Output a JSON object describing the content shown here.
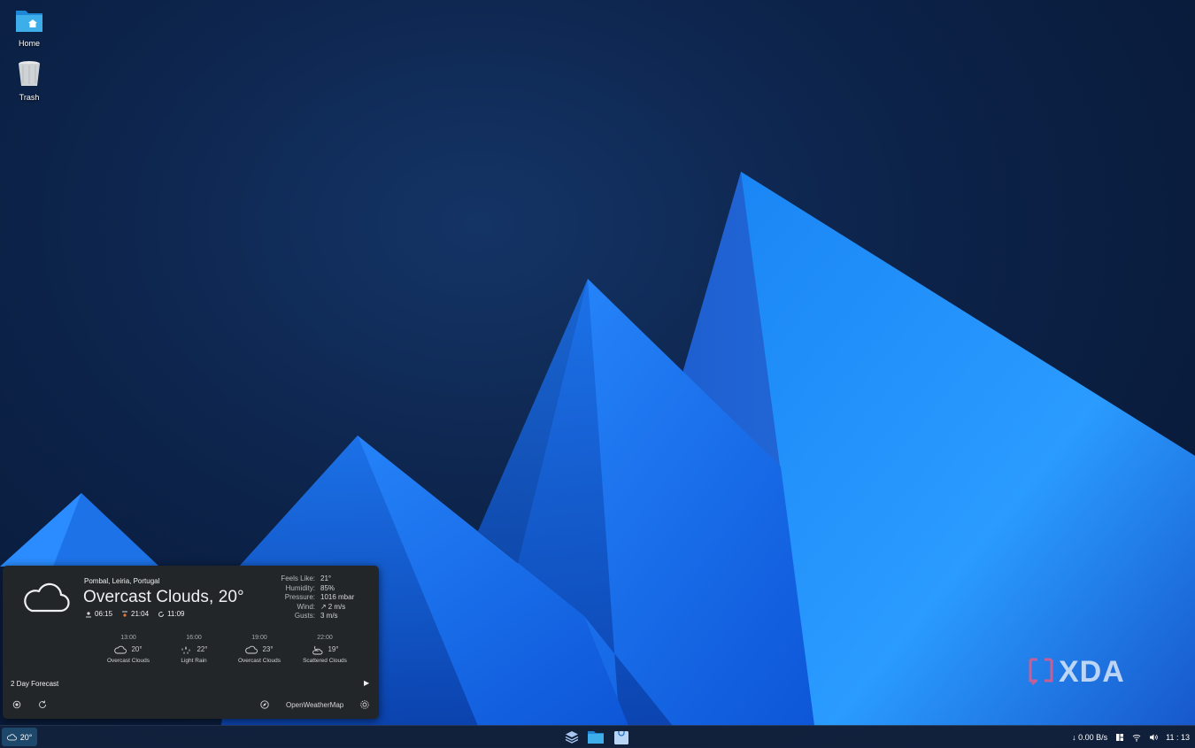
{
  "desktop": {
    "icons": [
      {
        "label": "Home",
        "icon": "folder-home-icon"
      },
      {
        "label": "Trash",
        "icon": "trash-icon"
      }
    ]
  },
  "weather": {
    "location": "Pombal, Leiria, Portugal",
    "condition": "Overcast Clouds, 20°",
    "sunrise": "06:15",
    "sunset": "21:04",
    "updated": "11:09",
    "details": [
      {
        "key": "Feels Like:",
        "value": "21°"
      },
      {
        "key": "Humidity:",
        "value": "85%"
      },
      {
        "key": "Pressure:",
        "value": "1016 mbar"
      },
      {
        "key": "Wind:",
        "value": "2 m/s"
      },
      {
        "key": "Gusts:",
        "value": "3 m/s"
      }
    ],
    "hourly": [
      {
        "time": "13:00",
        "temp": "20°",
        "desc": "Overcast Clouds",
        "icon": "cloud-icon"
      },
      {
        "time": "16:00",
        "temp": "22°",
        "desc": "Light Rain",
        "icon": "rain-icon"
      },
      {
        "time": "19:00",
        "temp": "23°",
        "desc": "Overcast Clouds",
        "icon": "cloud-icon"
      },
      {
        "time": "22:00",
        "temp": "19°",
        "desc": "Scattered Clouds",
        "icon": "night-cloud-icon"
      }
    ],
    "forecast_link": "2 Day Forecast",
    "provider": "OpenWeatherMap"
  },
  "taskbar": {
    "weather_temp": "20°",
    "net_speed": "↓ 0.00 B/s",
    "clock": "11 : 13"
  },
  "watermark": "XDA",
  "colors": {
    "accent": "#3daee9",
    "popup_bg": "#232629",
    "wallpaper_blue": "#1e7ef0"
  }
}
